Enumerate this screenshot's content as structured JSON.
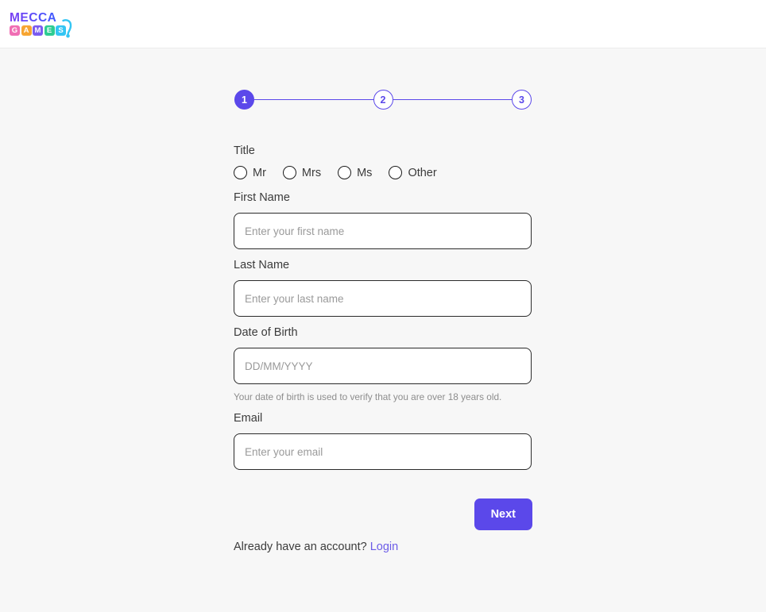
{
  "header": {
    "logo": {
      "word": "MECCA",
      "word_color": "#7b3ff2",
      "word_gradient_end": "#3d5afe",
      "tiles": [
        {
          "letter": "G",
          "color": "#f06eb4"
        },
        {
          "letter": "A",
          "color": "#f7a531"
        },
        {
          "letter": "M",
          "color": "#7b5cf0"
        },
        {
          "letter": "E",
          "color": "#2ecc92"
        },
        {
          "letter": "S",
          "color": "#33c5f3"
        }
      ],
      "controller_icon": "game-controller-icon",
      "controller_color": "#33c5f3"
    }
  },
  "stepper": {
    "accent_color": "#5b48ea",
    "steps": [
      {
        "number": "1",
        "state": "active"
      },
      {
        "number": "2",
        "state": "inactive"
      },
      {
        "number": "3",
        "state": "inactive"
      }
    ]
  },
  "form": {
    "title_field": {
      "label": "Title",
      "options": [
        {
          "value": "mr",
          "label": "Mr",
          "selected": false
        },
        {
          "value": "mrs",
          "label": "Mrs",
          "selected": false
        },
        {
          "value": "ms",
          "label": "Ms",
          "selected": false
        },
        {
          "value": "other",
          "label": "Other",
          "selected": false
        }
      ]
    },
    "first_name": {
      "label": "First Name",
      "placeholder": "Enter your first name",
      "value": ""
    },
    "last_name": {
      "label": "Last Name",
      "placeholder": "Enter your last name",
      "value": ""
    },
    "date_of_birth": {
      "label": "Date of Birth",
      "placeholder": "DD/MM/YYYY",
      "value": "",
      "helper": "Your date of birth is used to verify that you are over 18 years old."
    },
    "email": {
      "label": "Email",
      "placeholder": "Enter your email",
      "value": ""
    },
    "next_button": "Next",
    "account_prompt": "Already have an account?",
    "login_link": "Login"
  },
  "colors": {
    "accent": "#5b48ea",
    "link": "#6c5ce7",
    "page_background": "#f7f7f7",
    "header_background": "#ffffff",
    "input_border": "#2b2b2b",
    "placeholder": "#9a9a9a",
    "helper_text": "#8d8d8d"
  }
}
